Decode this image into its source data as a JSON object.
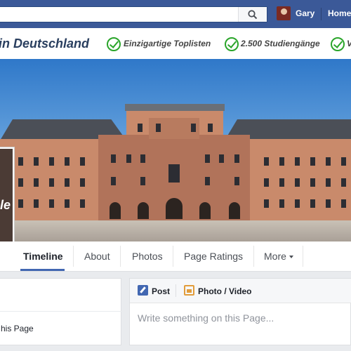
{
  "topbar": {
    "search_placeholder": "",
    "user_name": "Gary",
    "home_label": "Home"
  },
  "banner": {
    "title": "in Deutschland",
    "features": [
      {
        "label": "Einzigartige Toplisten"
      },
      {
        "label": "2.500 Studiengänge"
      },
      {
        "label": "V"
      }
    ]
  },
  "profile": {
    "partial_text": "le"
  },
  "tabs": [
    {
      "label": "Timeline",
      "active": true
    },
    {
      "label": "About"
    },
    {
      "label": "Photos"
    },
    {
      "label": "Page Ratings"
    },
    {
      "label": "More"
    }
  ],
  "leftcard": {
    "like_text": "his Page"
  },
  "composer": {
    "post_label": "Post",
    "photo_label": "Photo / Video",
    "input_placeholder": "Write something on this Page..."
  },
  "colors": {
    "brand": "#3b5998",
    "accent": "#4267b2",
    "check": "#2aa52a"
  }
}
